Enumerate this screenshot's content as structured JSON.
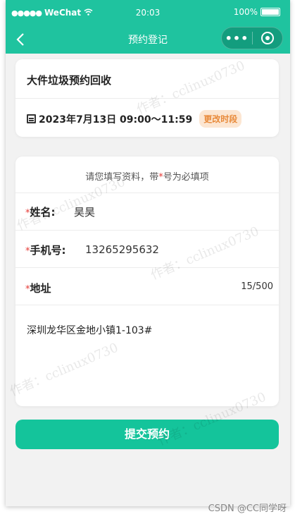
{
  "status_bar": {
    "carrier": "WeChat",
    "time": "20:03",
    "battery": "100%"
  },
  "nav": {
    "title": "预约登记",
    "more": "•••"
  },
  "service_card": {
    "title": "大件垃圾预约回收",
    "datetime": "2023年7月13日 09:00～11:59",
    "change_label": "更改时段"
  },
  "form": {
    "hint_prefix": "请您填写资料，带",
    "hint_star": "*",
    "hint_suffix": "号为必填项",
    "required_mark": "*",
    "name_label": "姓名:",
    "name_value": "昊昊",
    "phone_label": "手机号:",
    "phone_value": "13265295632",
    "address_label": "地址",
    "address_count": "15/500",
    "address_value": "深圳龙华区金地小镇1-103#"
  },
  "submit_label": "提交预约",
  "watermark": "作者：cclinux0730",
  "credit": "CSDN @CC同学呀",
  "colors": {
    "brand": "#1fc39f",
    "button": "#14c49b",
    "required": "#e53935",
    "tag_bg": "#fce6d2",
    "tag_text": "#e88a3a"
  }
}
